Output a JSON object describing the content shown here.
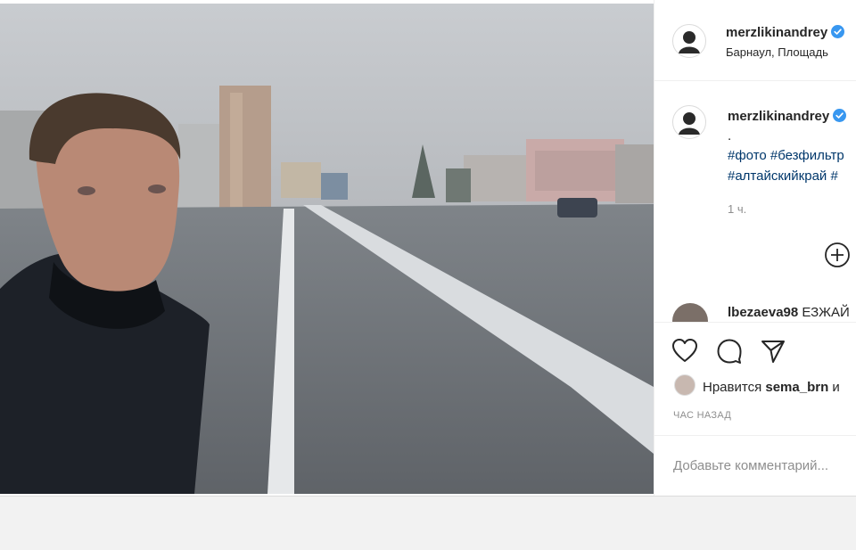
{
  "post": {
    "username": "merzlikinandrey",
    "location": "Барнаул, Площадь",
    "caption_dot": ".",
    "hashtags_line1": "#фото #безфильтр",
    "hashtags_line2": "#алтайскийкрай #",
    "caption_time": "1 ч.",
    "time_ago": "ЧАС НАЗАД"
  },
  "comment": {
    "username": "lbezaeva98",
    "text": "ЕЗЖАЙ"
  },
  "likes": {
    "prefix": "Нравится",
    "user": "sema_brn",
    "suffix": "и"
  },
  "add_comment": {
    "placeholder": "Добавьте комментарий..."
  },
  "colors": {
    "verified": "#3897f0",
    "hashtag": "#00376b",
    "muted": "#8e8e8e"
  },
  "icons": [
    "verified-icon",
    "add-icon",
    "heart-icon",
    "comment-icon",
    "share-icon"
  ]
}
